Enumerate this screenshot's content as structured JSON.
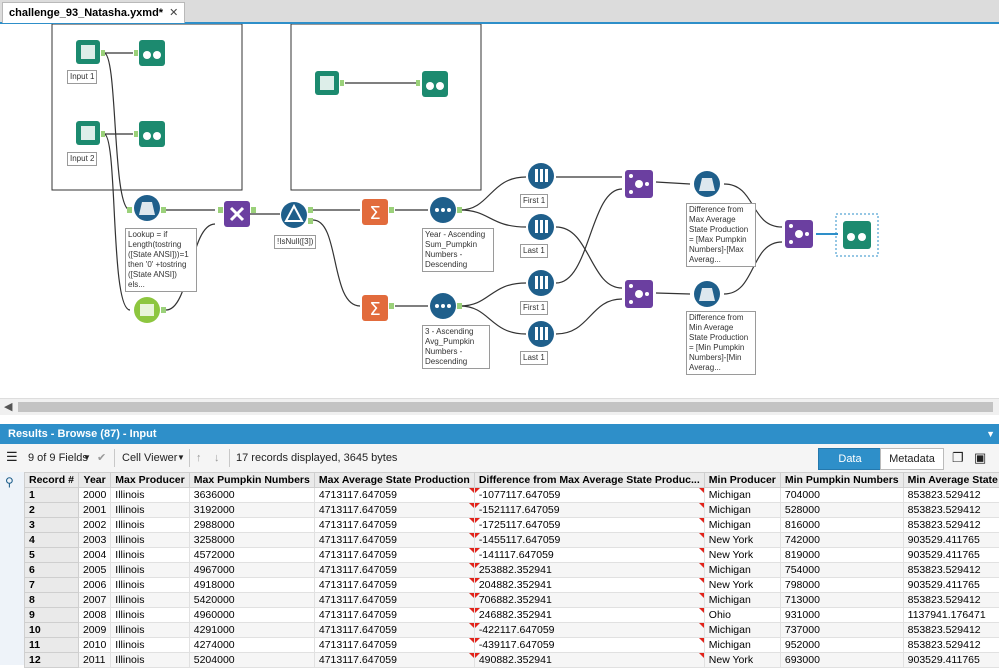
{
  "tab": {
    "title": "challenge_93_Natasha.yxmd*",
    "close": "✕"
  },
  "canvas": {
    "labels": {
      "input1": "Input 1",
      "input2": "Input 2",
      "formula": "Lookup = if\nLength(tostring\n([State ANSI]))=1\nthen '0' +tostring\n([State ANSI])\nels...",
      "filter": "!IsNull([3])",
      "sort1": "Year - Ascending\nSum_Pumpkin\nNumbers -\nDescending",
      "sort2": "3 - Ascending\nAvg_Pumpkin\nNumbers -\nDescending",
      "first1a": "First 1",
      "last1a": "Last 1",
      "first1b": "First 1",
      "last1b": "Last 1",
      "formula2": "Difference from\nMax Average\nState Production\n= [Max Pumpkin\nNumbers]-[Max\nAverag...",
      "formula3": "Difference from\nMin Average\nState Production\n= [Min Pumpkin\nNumbers]-[Min\nAverag..."
    }
  },
  "results": {
    "title": "Results - Browse (87) - Input",
    "fields": "9 of 9 Fields",
    "viewer": "Cell Viewer",
    "status": "17 records displayed, 3645 bytes",
    "data_btn": "Data",
    "meta_btn": "Metadata"
  },
  "table": {
    "headers": [
      "Record #",
      "Year",
      "Max Producer",
      "Max Pumpkin Numbers",
      "Max Average State Production",
      "Difference  from  Max  Average  State  Produc...",
      "Min Producer",
      "Min Pumpkin Numbers",
      "Min Average State P"
    ],
    "rows": [
      [
        "1",
        "2000",
        "Illinois",
        "3636000",
        "4713117.647059",
        "-1077117.647059",
        "Michigan",
        "704000",
        "853823.529412"
      ],
      [
        "2",
        "2001",
        "Illinois",
        "3192000",
        "4713117.647059",
        "-1521117.647059",
        "Michigan",
        "528000",
        "853823.529412"
      ],
      [
        "3",
        "2002",
        "Illinois",
        "2988000",
        "4713117.647059",
        "-1725117.647059",
        "Michigan",
        "816000",
        "853823.529412"
      ],
      [
        "4",
        "2003",
        "Illinois",
        "3258000",
        "4713117.647059",
        "-1455117.647059",
        "New York",
        "742000",
        "903529.411765"
      ],
      [
        "5",
        "2004",
        "Illinois",
        "4572000",
        "4713117.647059",
        "-141117.647059",
        "New York",
        "819000",
        "903529.411765"
      ],
      [
        "6",
        "2005",
        "Illinois",
        "4967000",
        "4713117.647059",
        "253882.352941",
        "Michigan",
        "754000",
        "853823.529412"
      ],
      [
        "7",
        "2006",
        "Illinois",
        "4918000",
        "4713117.647059",
        "204882.352941",
        "New York",
        "798000",
        "903529.411765"
      ],
      [
        "8",
        "2007",
        "Illinois",
        "5420000",
        "4713117.647059",
        "706882.352941",
        "Michigan",
        "713000",
        "853823.529412"
      ],
      [
        "9",
        "2008",
        "Illinois",
        "4960000",
        "4713117.647059",
        "246882.352941",
        "Ohio",
        "931000",
        "1137941.176471"
      ],
      [
        "10",
        "2009",
        "Illinois",
        "4291000",
        "4713117.647059",
        "-422117.647059",
        "Michigan",
        "737000",
        "853823.529412"
      ],
      [
        "11",
        "2010",
        "Illinois",
        "4274000",
        "4713117.647059",
        "-439117.647059",
        "Michigan",
        "952000",
        "853823.529412"
      ],
      [
        "12",
        "2011",
        "Illinois",
        "5204000",
        "4713117.647059",
        "490882.352941",
        "New York",
        "693000",
        "903529.411765"
      ]
    ]
  },
  "colors": {
    "accent": "#2e8fc9",
    "input": "#1c8a6f",
    "browse": "#1c8a6f",
    "formula": "#1f5f8b",
    "summarize": "#e26b3c",
    "join": "#6b3fa0",
    "sample": "#1f5f8b"
  }
}
